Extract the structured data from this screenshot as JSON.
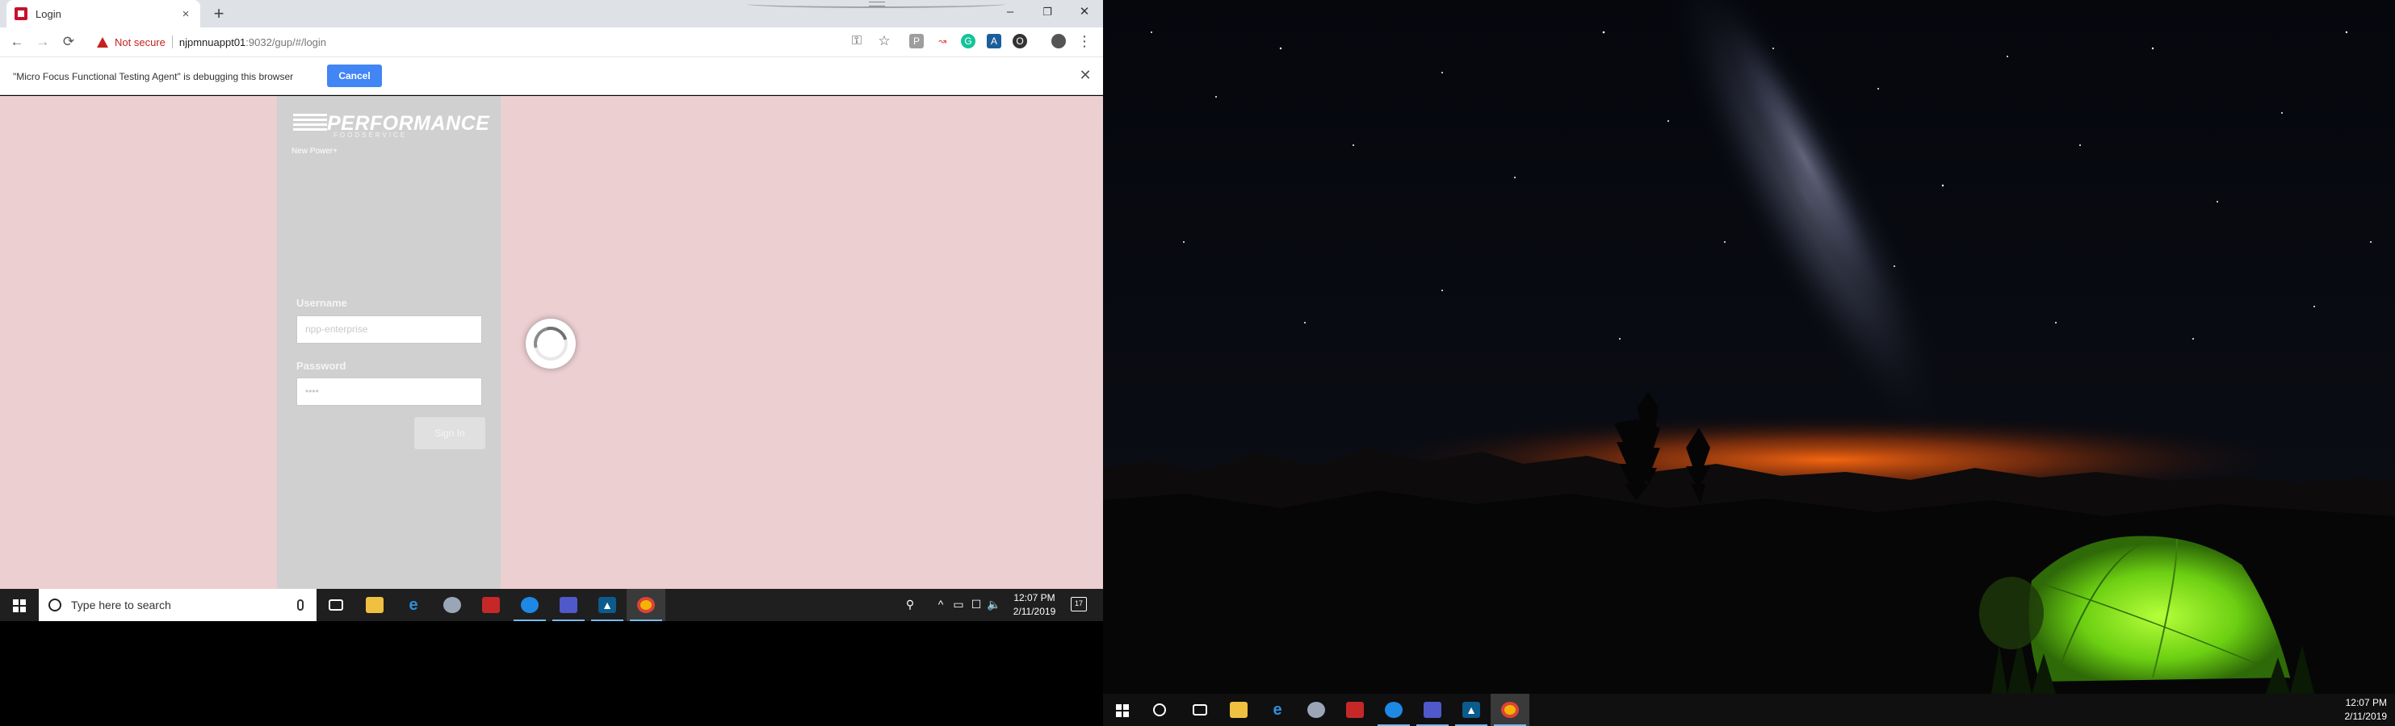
{
  "browser": {
    "tab_title": "Login",
    "tab_close": "×",
    "new_tab": "+",
    "minimize": "–",
    "restore": "❐",
    "close": "✕",
    "back": "←",
    "forward": "→",
    "reload": "⟳",
    "security_label": "Not secure",
    "url_host": "njpmnuappt01",
    "url_rest": ":9032/gup/#/login",
    "key_icon": "⚿",
    "star_icon": "☆",
    "menu_icon": "⋮",
    "extensions": [
      "P",
      "↝",
      "G",
      "A",
      "O"
    ]
  },
  "infobar": {
    "message": "\"Micro Focus Functional Testing Agent\" is debugging this browser",
    "cancel_label": "Cancel",
    "close_label": "✕"
  },
  "login": {
    "brand_name": "PERFORMANCE",
    "brand_sub": "FOODSERVICE",
    "tagline": "New Power+",
    "username_label": "Username",
    "username_value": "npp-enterprise",
    "password_label": "Password",
    "password_value": "••••",
    "signin_label": "Sign In"
  },
  "taskbar_left": {
    "search_placeholder": "Type here to search",
    "time": "12:07 PM",
    "date": "2/11/2019",
    "tray": [
      "⚲",
      "^",
      "▭",
      "☐",
      "🔈"
    ],
    "notification_count": "17"
  },
  "taskbar_right": {
    "time": "12:07 PM",
    "date": "2/11/2019"
  },
  "colors": {
    "page_bg": "#ebcfd1",
    "panel_bg": "#d0d0d0",
    "cancel_blue": "#4285f4",
    "warning_red": "#c5221f",
    "tent_green": "#7fe018"
  }
}
